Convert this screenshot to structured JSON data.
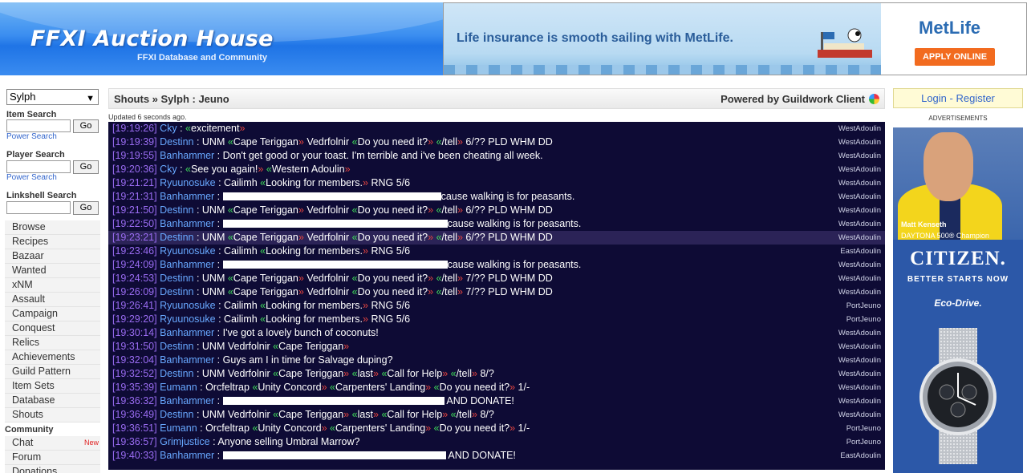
{
  "header": {
    "logo_title": "FFXI Auction House",
    "logo_subtitle": "FFXI Database and Community"
  },
  "banner_ad": {
    "text": "Life insurance is smooth sailing with MetLife.",
    "brand": "MetLife",
    "cta": "APPLY ONLINE"
  },
  "sidebar": {
    "server": "Sylph",
    "item_search_label": "Item Search",
    "player_search_label": "Player Search",
    "linkshell_search_label": "Linkshell Search",
    "go_label": "Go",
    "power_search": "Power Search",
    "nav": [
      "Browse",
      "Recipes",
      "Bazaar",
      "Wanted",
      "xNM",
      "Assault",
      "Campaign",
      "Conquest",
      "Relics",
      "Achievements",
      "Guild Pattern",
      "Item Sets",
      "Database",
      "Shouts"
    ],
    "community_label": "Community",
    "community_nav": [
      "Chat",
      "Forum",
      "Donations"
    ],
    "new_tag": "New"
  },
  "main": {
    "breadcrumb": "Shouts » Sylph : Jeuno",
    "powered_by": "Powered by Guildwork Client",
    "updated": "Updated 6 seconds ago."
  },
  "shouts": [
    {
      "time": "[19:19:26]",
      "name": "Cky",
      "parts": [
        [
          "t",
          " : "
        ],
        [
          "a",
          "excitement"
        ]
      ],
      "zone": "WestAdoulin"
    },
    {
      "time": "[19:19:39]",
      "name": "Destinn",
      "parts": [
        [
          "t",
          " : UNM "
        ],
        [
          "a",
          "Cape Teriggan"
        ],
        [
          "t",
          " Vedrfolnir "
        ],
        [
          "a",
          "Do you need it?"
        ],
        [
          "t",
          " "
        ],
        [
          "a",
          "/tell"
        ],
        [
          "t",
          " 6/?? PLD WHM DD"
        ]
      ],
      "zone": "WestAdoulin"
    },
    {
      "time": "[19:19:55]",
      "name": "Banhammer",
      "parts": [
        [
          "t",
          " : Don't get good or your toast. I'm terrible and i've been cheating all week."
        ]
      ],
      "zone": "WestAdoulin"
    },
    {
      "time": "[19:20:36]",
      "name": "Cky",
      "parts": [
        [
          "t",
          " : "
        ],
        [
          "a",
          "See you again!"
        ],
        [
          "t",
          " "
        ],
        [
          "a",
          "Western Adoulin"
        ]
      ],
      "zone": "WestAdoulin"
    },
    {
      "time": "[19:21:21]",
      "name": "Ryuunosuke",
      "parts": [
        [
          "t",
          " : Cailimh "
        ],
        [
          "a",
          "Looking for members."
        ],
        [
          "t",
          " RNG 5/6"
        ]
      ],
      "zone": "WestAdoulin"
    },
    {
      "time": "[19:21:31]",
      "name": "Banhammer",
      "parts": [
        [
          "t",
          " : "
        ],
        [
          "r",
          272
        ],
        [
          "t",
          "cause walking is for peasants."
        ]
      ],
      "zone": "WestAdoulin"
    },
    {
      "time": "[19:21:50]",
      "name": "Destinn",
      "parts": [
        [
          "t",
          " : UNM "
        ],
        [
          "a",
          "Cape Teriggan"
        ],
        [
          "t",
          " Vedrfolnir "
        ],
        [
          "a",
          "Do you need it?"
        ],
        [
          "t",
          " "
        ],
        [
          "a",
          "/tell"
        ],
        [
          "t",
          " 6/?? PLD WHM DD"
        ]
      ],
      "zone": "WestAdoulin"
    },
    {
      "time": "[19:22:50]",
      "name": "Banhammer",
      "parts": [
        [
          "t",
          " : "
        ],
        [
          "r",
          280
        ],
        [
          "t",
          "cause walking is for peasants."
        ]
      ],
      "zone": "WestAdoulin"
    },
    {
      "time": "[19:23:21]",
      "name": "Destinn",
      "parts": [
        [
          "t",
          " : UNM "
        ],
        [
          "a",
          "Cape Teriggan"
        ],
        [
          "t",
          " Vedrfolnir "
        ],
        [
          "a",
          "Do you need it?"
        ],
        [
          "t",
          " "
        ],
        [
          "a",
          "/tell"
        ],
        [
          "t",
          " 6/?? PLD WHM DD"
        ]
      ],
      "zone": "WestAdoulin",
      "highlight": true
    },
    {
      "time": "[19:23:46]",
      "name": "Ryuunosuke",
      "parts": [
        [
          "t",
          " : Cailimh "
        ],
        [
          "a",
          "Looking for members."
        ],
        [
          "t",
          " RNG 5/6"
        ]
      ],
      "zone": "EastAdoulin"
    },
    {
      "time": "[19:24:09]",
      "name": "Banhammer",
      "parts": [
        [
          "t",
          " : "
        ],
        [
          "r",
          280
        ],
        [
          "t",
          "cause walking is for peasants."
        ]
      ],
      "zone": "WestAdoulin"
    },
    {
      "time": "[19:24:53]",
      "name": "Destinn",
      "parts": [
        [
          "t",
          " : UNM "
        ],
        [
          "a",
          "Cape Teriggan"
        ],
        [
          "t",
          " Vedrfolnir "
        ],
        [
          "a",
          "Do you need it?"
        ],
        [
          "t",
          " "
        ],
        [
          "a",
          "/tell"
        ],
        [
          "t",
          " 7/?? PLD WHM DD"
        ]
      ],
      "zone": "WestAdoulin"
    },
    {
      "time": "[19:26:09]",
      "name": "Destinn",
      "parts": [
        [
          "t",
          " : UNM "
        ],
        [
          "a",
          "Cape Teriggan"
        ],
        [
          "t",
          " Vedrfolnir "
        ],
        [
          "a",
          "Do you need it?"
        ],
        [
          "t",
          " "
        ],
        [
          "a",
          "/tell"
        ],
        [
          "t",
          " 7/?? PLD WHM DD"
        ]
      ],
      "zone": "WestAdoulin"
    },
    {
      "time": "[19:26:41]",
      "name": "Ryuunosuke",
      "parts": [
        [
          "t",
          " : Cailimh "
        ],
        [
          "a",
          "Looking for members."
        ],
        [
          "t",
          " RNG 5/6"
        ]
      ],
      "zone": "PortJeuno"
    },
    {
      "time": "[19:29:20]",
      "name": "Ryuunosuke",
      "parts": [
        [
          "t",
          " : Cailimh "
        ],
        [
          "a",
          "Looking for members."
        ],
        [
          "t",
          " RNG 5/6"
        ]
      ],
      "zone": "PortJeuno"
    },
    {
      "time": "[19:30:14]",
      "name": "Banhammer",
      "parts": [
        [
          "t",
          " : I've got a lovely bunch of coconuts!"
        ]
      ],
      "zone": "WestAdoulin"
    },
    {
      "time": "[19:31:50]",
      "name": "Destinn",
      "parts": [
        [
          "t",
          " : UNM Vedrfolnir "
        ],
        [
          "a",
          "Cape Teriggan"
        ]
      ],
      "zone": "WestAdoulin"
    },
    {
      "time": "[19:32:04]",
      "name": "Banhammer",
      "parts": [
        [
          "t",
          " : Guys am I in time for Salvage duping?"
        ]
      ],
      "zone": "WestAdoulin"
    },
    {
      "time": "[19:32:52]",
      "name": "Destinn",
      "parts": [
        [
          "t",
          " : UNM Vedrfolnir "
        ],
        [
          "a",
          "Cape Teriggan"
        ],
        [
          "t",
          " "
        ],
        [
          "a",
          "last"
        ],
        [
          "t",
          " "
        ],
        [
          "a",
          "Call for Help"
        ],
        [
          "t",
          " "
        ],
        [
          "a",
          "/tell"
        ],
        [
          "t",
          " 8/?"
        ]
      ],
      "zone": "WestAdoulin"
    },
    {
      "time": "[19:35:39]",
      "name": "Eumann",
      "parts": [
        [
          "t",
          " : Orcfeltrap "
        ],
        [
          "a",
          "Unity Concord"
        ],
        [
          "t",
          " "
        ],
        [
          "a",
          "Carpenters' Landing"
        ],
        [
          "t",
          " "
        ],
        [
          "a",
          "Do you need it?"
        ],
        [
          "t",
          " 1/-"
        ]
      ],
      "zone": "WestAdoulin"
    },
    {
      "time": "[19:36:32]",
      "name": "Banhammer",
      "parts": [
        [
          "t",
          " : "
        ],
        [
          "r",
          276
        ],
        [
          "t",
          " AND DONATE!"
        ]
      ],
      "zone": "WestAdoulin"
    },
    {
      "time": "[19:36:49]",
      "name": "Destinn",
      "parts": [
        [
          "t",
          " : UNM Vedrfolnir "
        ],
        [
          "a",
          "Cape Teriggan"
        ],
        [
          "t",
          " "
        ],
        [
          "a",
          "last"
        ],
        [
          "t",
          " "
        ],
        [
          "a",
          "Call for Help"
        ],
        [
          "t",
          " "
        ],
        [
          "a",
          "/tell"
        ],
        [
          "t",
          " 8/?"
        ]
      ],
      "zone": "WestAdoulin"
    },
    {
      "time": "[19:36:51]",
      "name": "Eumann",
      "parts": [
        [
          "t",
          " : Orcfeltrap "
        ],
        [
          "a",
          "Unity Concord"
        ],
        [
          "t",
          " "
        ],
        [
          "a",
          "Carpenters' Landing"
        ],
        [
          "t",
          " "
        ],
        [
          "a",
          "Do you need it?"
        ],
        [
          "t",
          " 1/-"
        ]
      ],
      "zone": "PortJeuno"
    },
    {
      "time": "[19:36:57]",
      "name": "Grimjustice",
      "parts": [
        [
          "t",
          " : Anyone selling Umbral Marrow?"
        ]
      ],
      "zone": "PortJeuno"
    },
    {
      "time": "[19:40:33]",
      "name": "Banhammer",
      "parts": [
        [
          "t",
          " : "
        ],
        [
          "r",
          278
        ],
        [
          "t",
          " AND DONATE!"
        ]
      ],
      "zone": "EastAdoulin"
    }
  ],
  "right": {
    "login": "Login",
    "separator": " - ",
    "register": "Register",
    "ads_label": "ADVERTISEMENTS",
    "citizen_person": "Matt Kenseth",
    "citizen_daytona": "DAYTONA 500® Champion",
    "citizen_brand": "CITIZEN.",
    "citizen_tagline": "BETTER STARTS NOW",
    "citizen_eco": "Eco-Drive."
  }
}
